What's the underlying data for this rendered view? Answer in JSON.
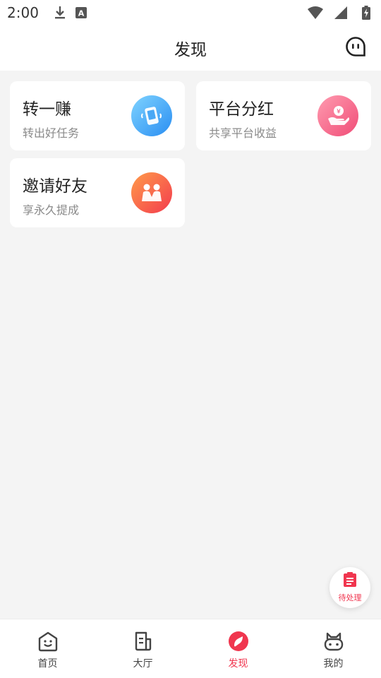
{
  "status_bar": {
    "time": "2:00",
    "left_icons": [
      "download-icon",
      "a-font-icon"
    ],
    "right_icons": [
      "wifi-icon",
      "signal-icon",
      "battery-charging-icon"
    ]
  },
  "header": {
    "title": "发现",
    "chat_icon": "chat-bubble-icon"
  },
  "cards": [
    {
      "title": "转一赚",
      "subtitle": "转出好任务",
      "icon": "phone-share-icon",
      "icon_color": "#2a8ef2"
    },
    {
      "title": "平台分红",
      "subtitle": "共享平台收益",
      "icon": "hand-yen-icon",
      "icon_color": "#f04d77"
    },
    {
      "title": "邀请好友",
      "subtitle": "享永久提成",
      "icon": "friends-icon",
      "icon_color": "#f33b4e"
    }
  ],
  "floating": {
    "label": "待处理",
    "icon": "clipboard-icon"
  },
  "bottom_nav": {
    "items": [
      {
        "label": "首页",
        "icon": "home-face-icon",
        "active": false
      },
      {
        "label": "大厅",
        "icon": "hall-icon",
        "active": false
      },
      {
        "label": "发现",
        "icon": "compass-icon",
        "active": true
      },
      {
        "label": "我的",
        "icon": "profile-cat-icon",
        "active": false
      }
    ]
  },
  "colors": {
    "accent": "#f0364f",
    "background": "#f4f4f4"
  }
}
